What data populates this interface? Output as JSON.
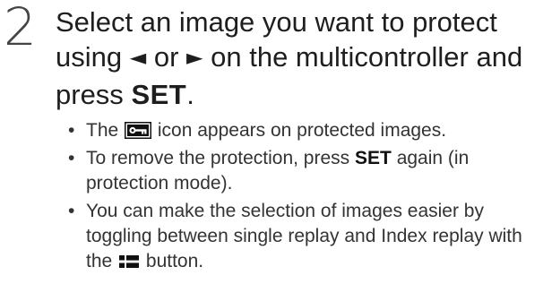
{
  "step": {
    "number": "2",
    "heading": {
      "part1": "Select an image you want to protect using",
      "left_arrow": "◄",
      "or_text": "or",
      "right_arrow": "►",
      "part2": "on the multicontroller and press",
      "set_label": "SET",
      "end": "."
    }
  },
  "bullets": [
    {
      "prefix": "The",
      "icon": "protect-icon",
      "suffix": "icon appears on protected images."
    },
    {
      "prefix": "To remove the protection, press",
      "key": "SET",
      "suffix": "again (in protection mode)."
    },
    {
      "prefix": "You can make the selection of images easier by toggling between single replay and Index replay with the",
      "icon": "index-replay-icon",
      "suffix": "button."
    }
  ],
  "colors": {
    "text": "#222222",
    "icon": "#111111"
  }
}
